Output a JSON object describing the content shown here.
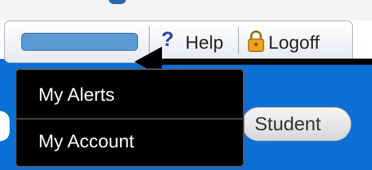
{
  "header": {
    "help_label": "Help",
    "logoff_label": "Logoff",
    "user_field_value": ""
  },
  "dropdown": {
    "items": [
      {
        "label": "My Alerts"
      },
      {
        "label": "My Account"
      }
    ]
  },
  "student_button": {
    "label": "Student"
  },
  "icons": {
    "help": "question-mark-icon",
    "logoff": "lock-icon",
    "annotation": "left-arrow-icon"
  },
  "colors": {
    "page_background": "#0b6fd4",
    "user_field": "#5b9bd5",
    "help_icon": "#2446a0",
    "dropdown_bg": "#000000",
    "lock": "#f2a31b"
  }
}
